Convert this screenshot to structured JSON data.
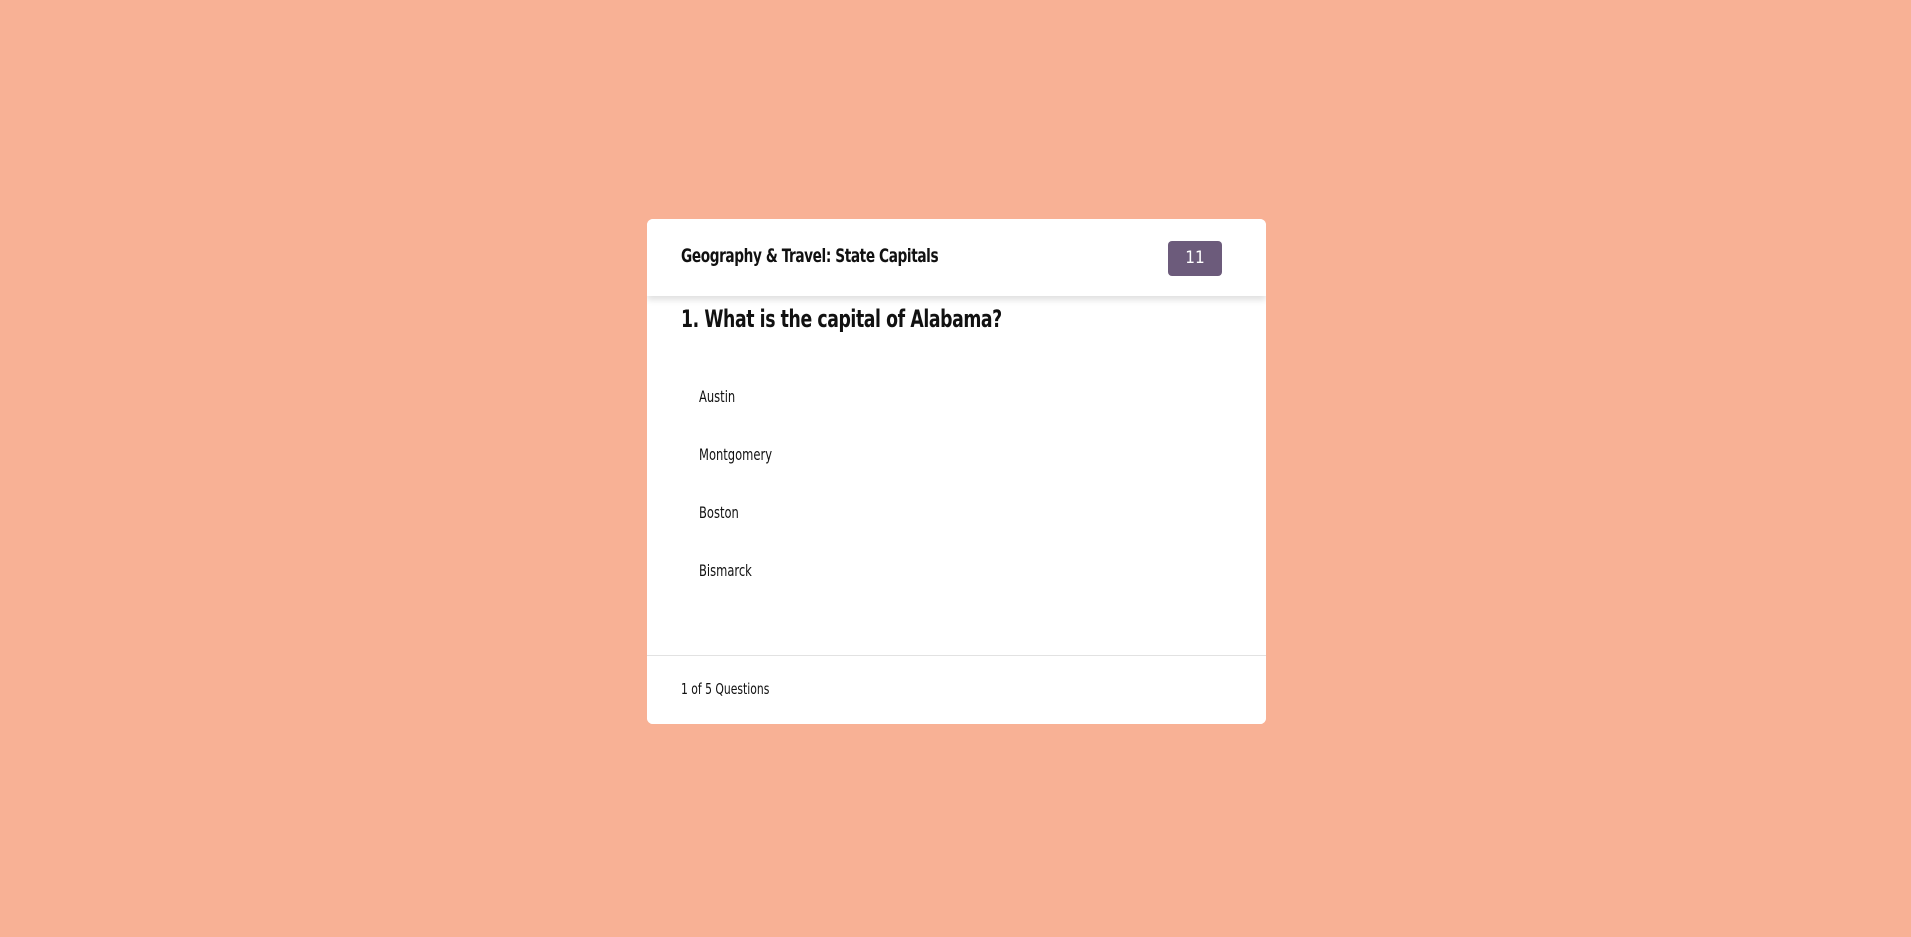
{
  "quiz": {
    "title": "Geography & Travel: State Capitals",
    "timer": "11",
    "question": "1. What is the capital of Alabama?",
    "answers": [
      "Austin",
      "Montgomery",
      "Boston",
      "Bismarck"
    ],
    "progress": "1 of 5 Questions"
  },
  "colors": {
    "background": "#f8b195",
    "accent": "#6c5b7b",
    "card": "#ffffff"
  }
}
